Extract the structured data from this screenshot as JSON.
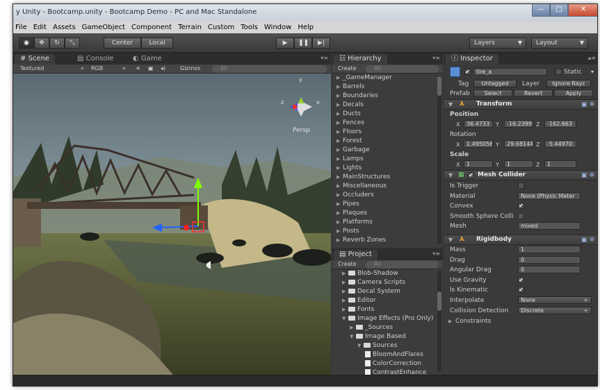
{
  "window": {
    "title": "y Unity - Bootcamp.unity - Bootcamp Demo - PC and Mac Standalone",
    "buttons": [
      "—",
      "□",
      "✕"
    ]
  },
  "menu": [
    "File",
    "Edit",
    "Assets",
    "GameObject",
    "Component",
    "Terrain",
    "Custom",
    "Tools",
    "Window",
    "Help"
  ],
  "toolbar": {
    "tools": [
      "◉",
      "✥",
      "↻",
      "⤡"
    ],
    "pivot": "Center",
    "space": "Local",
    "play": "▶",
    "pause": "❚❚",
    "step": "▶|",
    "layers": "Layers",
    "layout": "Layout"
  },
  "scene": {
    "tabs": [
      "Scene",
      "Console",
      "Game"
    ],
    "shading": "Textured",
    "render_mode": "RGB",
    "gizmos": "Gizmos",
    "search_placeholder": "All",
    "gizmo": {
      "x": "x",
      "y": "y",
      "z": "z",
      "view": "Persp"
    }
  },
  "hierarchy": {
    "tab": "Hierarchy",
    "create": "Create",
    "search_placeholder": "All",
    "items": [
      "_GameManager",
      "Barrels",
      "Boundaries",
      "Decals",
      "Ducts",
      "Fences",
      "Floors",
      "Forest",
      "Garbage",
      "Lamps",
      "Lights",
      "MainStructures",
      "Miscellaneous",
      "Occluders",
      "Pipes",
      "Plaques",
      "Platforms",
      "Posts",
      "Reverb Zones"
    ]
  },
  "project": {
    "tab": "Project",
    "create": "Create",
    "search_placeholder": "All",
    "items": [
      {
        "label": "Blob-Shadow",
        "depth": 0,
        "open": false
      },
      {
        "label": "Camera Scripts",
        "depth": 0,
        "open": false
      },
      {
        "label": "Decal System",
        "depth": 0,
        "open": false
      },
      {
        "label": "Editor",
        "depth": 0,
        "open": false
      },
      {
        "label": "Fonts",
        "depth": 0,
        "open": false
      },
      {
        "label": "Image Effects (Pro Only)",
        "depth": 0,
        "open": true
      },
      {
        "label": "_Sources",
        "depth": 1,
        "open": false
      },
      {
        "label": "Image Based",
        "depth": 1,
        "open": true
      },
      {
        "label": "Sources",
        "depth": 2,
        "open": true
      },
      {
        "label": "BloomAndFlares",
        "depth": 3,
        "file": true
      },
      {
        "label": "ColorCorrection",
        "depth": 3,
        "file": true
      },
      {
        "label": "ContrastEnhance",
        "depth": 3,
        "file": true
      }
    ]
  },
  "inspector": {
    "tab": "Inspector",
    "object_name": "tire_a",
    "static_label": "Static",
    "tag_label": "Tag",
    "tag_value": "Untagged",
    "layer_label": "Layer",
    "layer_value": "Ignore Rayc",
    "prefab_label": "Prefab",
    "prefab_buttons": [
      "Select",
      "Revert",
      "Apply"
    ],
    "transform": {
      "title": "Transform",
      "position_label": "Position",
      "rotation_label": "Rotation",
      "scale_label": "Scale",
      "axes": [
        "X",
        "Y",
        "Z"
      ],
      "position": [
        "36.4733",
        "-16.2399",
        "-162.663"
      ],
      "rotation": [
        "1.495056",
        "29.68144",
        "-5.44970"
      ],
      "scale": [
        "1",
        "1",
        "1"
      ]
    },
    "mesh_collider": {
      "title": "Mesh Collider",
      "rows": [
        {
          "label": "Is Trigger",
          "type": "check",
          "value": ""
        },
        {
          "label": "Material",
          "type": "field",
          "value": "None (Physic Mater"
        },
        {
          "label": "Convex",
          "type": "check",
          "value": "✔"
        },
        {
          "label": "Smooth Sphere Colli",
          "type": "check",
          "value": ""
        },
        {
          "label": "Mesh",
          "type": "field",
          "value": "mixed"
        }
      ]
    },
    "rigidbody": {
      "title": "Rigidbody",
      "rows": [
        {
          "label": "Mass",
          "type": "field",
          "value": "1"
        },
        {
          "label": "Drag",
          "type": "field",
          "value": "0"
        },
        {
          "label": "Angular Drag",
          "type": "field",
          "value": "0"
        },
        {
          "label": "Use Gravity",
          "type": "check",
          "value": "✔"
        },
        {
          "label": "Is Kinematic",
          "type": "check",
          "value": "✔"
        },
        {
          "label": "Interpolate",
          "type": "select",
          "value": "None"
        },
        {
          "label": "Collision Detection",
          "type": "select",
          "value": "Discrete"
        }
      ],
      "constraints": "Constraints"
    }
  }
}
